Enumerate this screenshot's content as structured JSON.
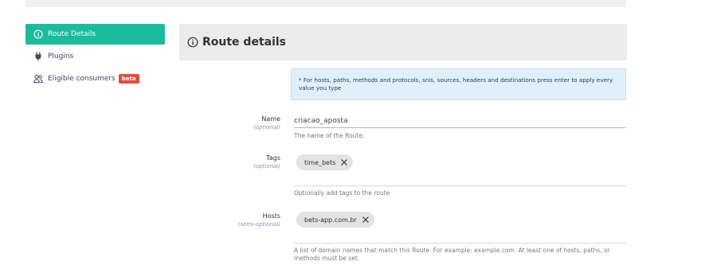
{
  "sidebar": {
    "items": [
      {
        "label": "Route Details",
        "icon": "info-circle-icon"
      },
      {
        "label": "Plugins",
        "icon": "plug-icon"
      },
      {
        "label": "Eligible consumers",
        "icon": "users-icon",
        "badge": "beta"
      }
    ]
  },
  "panel": {
    "title": "Route details",
    "info": "* For hosts, paths, methods and protocols, snis, sources, headers and destinations press enter to apply every value you type"
  },
  "form": {
    "name": {
      "label": "Name",
      "qualifier": "(optional)",
      "value": "criacao_aposta",
      "help": "The name of the Route."
    },
    "tags": {
      "label": "Tags",
      "qualifier": "(optional)",
      "chips": [
        "time_bets"
      ],
      "help": "Optionally add tags to the route"
    },
    "hosts": {
      "label": "Hosts",
      "qualifier": "(semi-optional)",
      "chips": [
        "bets-app.com.br"
      ],
      "help": "A list of domain names that match this Route. For example: example.com. At least one of hosts, paths, or methods must be set."
    }
  },
  "colors": {
    "accent": "#1abc9c",
    "beta": "#e74c3c",
    "info_bg": "#e1effa"
  }
}
